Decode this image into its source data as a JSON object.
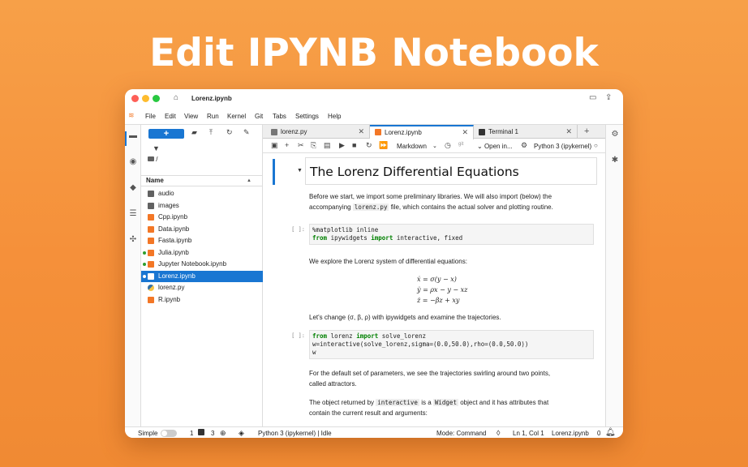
{
  "headline": "Edit IPYNB Notebook",
  "window": {
    "title": "Lorenz.ipynb",
    "traffic_colors": [
      "#fe5f57",
      "#febc2e",
      "#28c840"
    ]
  },
  "menu": [
    "File",
    "Edit",
    "View",
    "Run",
    "Kernel",
    "Git",
    "Tabs",
    "Settings",
    "Help"
  ],
  "file_browser": {
    "new_label": "+",
    "path": "/",
    "column_header": "Name",
    "items": [
      {
        "name": "audio",
        "kind": "folder",
        "running": false,
        "selected": false
      },
      {
        "name": "images",
        "kind": "folder",
        "running": false,
        "selected": false
      },
      {
        "name": "Cpp.ipynb",
        "kind": "notebook",
        "running": false,
        "selected": false
      },
      {
        "name": "Data.ipynb",
        "kind": "notebook",
        "running": false,
        "selected": false
      },
      {
        "name": "Fasta.ipynb",
        "kind": "notebook",
        "running": false,
        "selected": false
      },
      {
        "name": "Julia.ipynb",
        "kind": "notebook",
        "running": true,
        "selected": false
      },
      {
        "name": "Jupyter Notebook.ipynb",
        "kind": "notebook",
        "running": true,
        "selected": false
      },
      {
        "name": "Lorenz.ipynb",
        "kind": "notebook",
        "running": true,
        "selected": true
      },
      {
        "name": "lorenz.py",
        "kind": "python",
        "running": false,
        "selected": false
      },
      {
        "name": "R.ipynb",
        "kind": "notebook",
        "running": false,
        "selected": false
      }
    ]
  },
  "tabs": [
    {
      "label": "lorenz.py",
      "active": false
    },
    {
      "label": "Lorenz.ipynb",
      "active": true
    },
    {
      "label": "Terminal 1",
      "active": false
    }
  ],
  "toolbar": {
    "cell_type": "Markdown",
    "git_label": "git",
    "open_in": "Open in...",
    "kernel": "Python 3 (ipykernel)"
  },
  "notebook": {
    "heading": "The Lorenz Differential Equations",
    "intro_1": "Before we start, we import some preliminary libraries. We will also import (below) the",
    "intro_2a": "accompanying",
    "intro_2_code": "lorenz.py",
    "intro_2b": "file, which contains the actual solver and plotting routine.",
    "prompt_1": "[ ]:",
    "code_1_line1": "%matplotlib inline",
    "code_1_kw1": "from",
    "code_1_mod": " ipywidgets ",
    "code_1_kw2": "import",
    "code_1_rest": " interactive, fixed",
    "explore": "We explore the Lorenz system of differential equations:",
    "eq1": "ẋ = σ(y − x)",
    "eq2": "ẏ = ρx − y − xz",
    "eq3": "ż = −βz + xy",
    "change": "Let's change (σ, β, ρ) with ipywidgets and examine the trajectories.",
    "prompt_2": "[ ]:",
    "code_2_kw1": "from",
    "code_2_mod": " lorenz ",
    "code_2_kw2": "import",
    "code_2_rest": " solve_lorenz",
    "code_2_line2": "w=interactive(solve_lorenz,sigma=(0.0,50.0),rho=(0.0,50.0))",
    "code_2_line3": "w",
    "default_1": "For the default set of parameters, we see the trajectories swirling around two points,",
    "default_2": "called attractors.",
    "object_1a": "The object returned by",
    "object_code1": "interactive",
    "object_1b": "is a",
    "object_code2": "Widget",
    "object_1c": "object and it has attributes that",
    "object_2": "contain the current result and arguments:"
  },
  "status": {
    "mode_label": "Simple",
    "count_1": "1",
    "count_2": "3",
    "kernel_status": "Python 3 (ipykernel) | Idle",
    "command_mode": "Mode: Command",
    "cursor": "Ln 1, Col 1",
    "file": "Lorenz.ipynb",
    "notifications": "0"
  }
}
